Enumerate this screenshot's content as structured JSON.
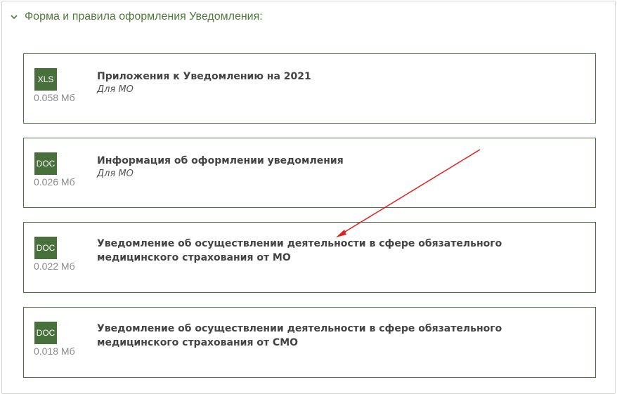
{
  "section": {
    "title": "Форма и правила оформления Уведомления:",
    "icon": "chevron-down-icon"
  },
  "documents": [
    {
      "type": "XLS",
      "size": "0.058 Мб",
      "title": "Приложения к Уведомлению на 2021",
      "subtitle": "Для МО"
    },
    {
      "type": "DOC",
      "size": "0.026 Мб",
      "title": "Информация об оформлении уведомления",
      "subtitle": "Для МО"
    },
    {
      "type": "DOC",
      "size": "0.022 Мб",
      "title": "Уведомление об осуществлении деятельности в сфере обязательного медицинского страхования от МО",
      "subtitle": ""
    },
    {
      "type": "DOC",
      "size": "0.018 Мб",
      "title": "Уведомление об осуществлении деятельности в сфере обязательного медицинского страхования от СМО",
      "subtitle": ""
    }
  ],
  "colors": {
    "accent": "#4e7a3c",
    "badge": "#48703a",
    "card_border": "#4e7043",
    "annotation_arrow": "#e02020"
  }
}
